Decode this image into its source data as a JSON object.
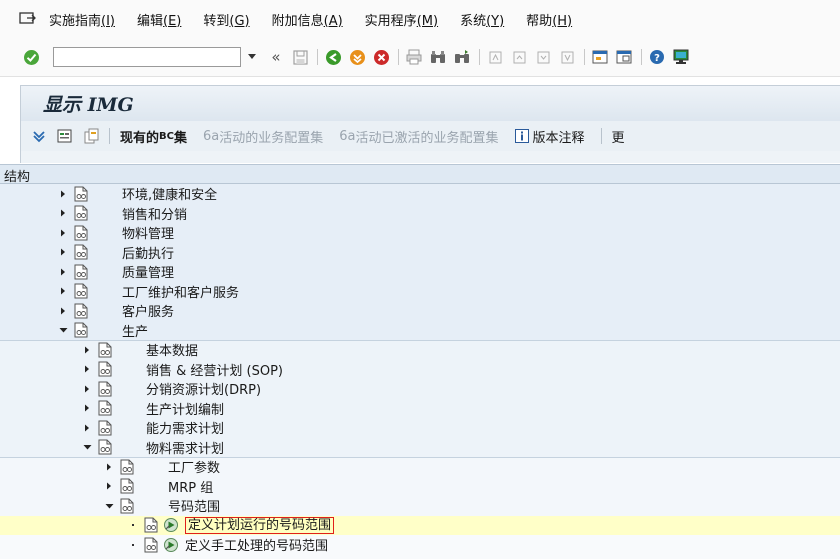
{
  "menu": {
    "items": [
      {
        "label": "实施指南",
        "key": "(I)"
      },
      {
        "label": "编辑",
        "key": "(E)"
      },
      {
        "label": "转到",
        "key": "(G)"
      },
      {
        "label": "附加信息",
        "key": "(A)"
      },
      {
        "label": "实用程序",
        "key": "(M)"
      },
      {
        "label": "系统",
        "key": "(Y)"
      },
      {
        "label": "帮助",
        "key": "(H)"
      }
    ]
  },
  "toolbar": {
    "command_value": "",
    "collapse_glyph": "«"
  },
  "title": "显示 IMG",
  "app_toolbar": {
    "current_bc_prefix": "现有的 ",
    "current_bc_caps": "BC",
    "current_bc_suffix": " 集",
    "active_bc_prefix": "6a",
    "active_bc_label": "活动的业务配置集",
    "activated_bc_prefix": "6a",
    "activated_bc_label": "活动已激活的业务配置集",
    "release_notes_label": "版本注释",
    "cut_label": "更"
  },
  "tree": {
    "header": "结构",
    "rows": [
      {
        "label": "环境,健康和安全",
        "level": 1,
        "state": "collapsed"
      },
      {
        "label": "销售和分销",
        "level": 1,
        "state": "collapsed"
      },
      {
        "label": "物料管理",
        "level": 1,
        "state": "collapsed"
      },
      {
        "label": "后勤执行",
        "level": 1,
        "state": "collapsed"
      },
      {
        "label": "质量管理",
        "level": 1,
        "state": "collapsed"
      },
      {
        "label": "工厂维护和客户服务",
        "level": 1,
        "state": "collapsed"
      },
      {
        "label": "客户服务",
        "level": 1,
        "state": "collapsed"
      },
      {
        "label": "生产",
        "level": 1,
        "state": "expanded"
      },
      {
        "label": "基本数据",
        "level": 2,
        "state": "collapsed"
      },
      {
        "label": "销售 & 经营计划 (SOP)",
        "level": 2,
        "state": "collapsed"
      },
      {
        "label": "分销资源计划(DRP)",
        "level": 2,
        "state": "collapsed"
      },
      {
        "label": "生产计划编制",
        "level": 2,
        "state": "collapsed"
      },
      {
        "label": "能力需求计划",
        "level": 2,
        "state": "collapsed"
      },
      {
        "label": "物料需求计划",
        "level": 2,
        "state": "expanded"
      },
      {
        "label": "工厂参数",
        "level": 3,
        "state": "collapsed"
      },
      {
        "label": "MRP 组",
        "level": 3,
        "state": "collapsed"
      },
      {
        "label": "号码范围",
        "level": 3,
        "state": "expanded"
      },
      {
        "label": "定义计划运行的号码范围",
        "level": 4,
        "state": "leaf",
        "selected": true
      },
      {
        "label": "定义手工处理的号码范围",
        "level": 4,
        "state": "leaf",
        "selected": false
      }
    ]
  },
  "colors": {
    "accent_green": "#3a9a2a",
    "accent_orange": "#e07a10",
    "accent_red": "#cc2a2a",
    "selection_border": "#e0201a",
    "selection_fill": "#ffffc0"
  }
}
